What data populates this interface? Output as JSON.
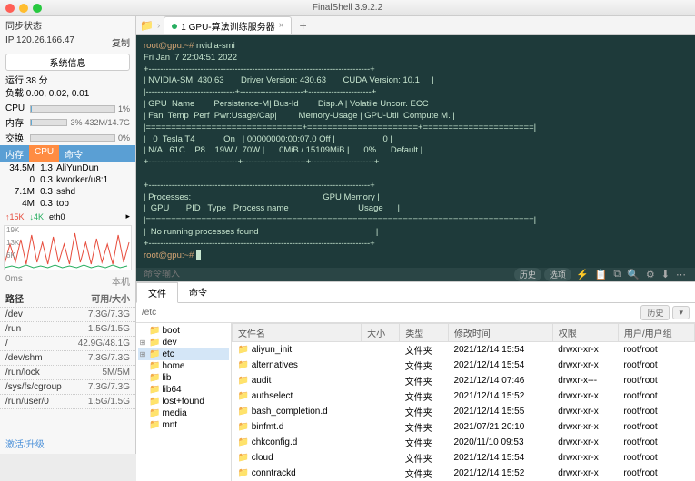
{
  "window": {
    "title": "FinalShell 3.9.2.2"
  },
  "sidebar": {
    "syncLabel": "同步状态",
    "ip": "IP 120.26.166.47",
    "copy": "复制",
    "sysinfo": "系统信息",
    "uptime": "运行 38 分",
    "load": "负载 0.00, 0.02, 0.01",
    "cpu": {
      "label": "CPU",
      "pct": "1%",
      "fill": 1
    },
    "mem": {
      "label": "内存",
      "pct": "3%",
      "val": "432M/14.7G",
      "fill": 3
    },
    "swap": {
      "label": "交换",
      "pct": "0%",
      "fill": 0
    },
    "tabs": {
      "mem": "内存",
      "cpu": "CPU",
      "cmd": "命令"
    },
    "procs": [
      {
        "m": "34.5M",
        "c": "1.3",
        "n": "AliYunDun"
      },
      {
        "m": "0",
        "c": "0.3",
        "n": "kworker/u8:1"
      },
      {
        "m": "7.1M",
        "c": "0.3",
        "n": "sshd"
      },
      {
        "m": "4M",
        "c": "0.3",
        "n": "top"
      }
    ],
    "net": {
      "up": "↑15K",
      "down": "↓4K",
      "iface": "eth0",
      "y1": "19K",
      "y2": "13K",
      "y3": "6K",
      "lat": "0ms",
      "z1": "0",
      "z2": "0"
    },
    "pathHead": {
      "p": "路径",
      "s": "可用/大小"
    },
    "paths": [
      {
        "p": "/dev",
        "s": "7.3G/7.3G"
      },
      {
        "p": "/run",
        "s": "1.5G/1.5G"
      },
      {
        "p": "/",
        "s": "42.9G/48.1G"
      },
      {
        "p": "/dev/shm",
        "s": "7.3G/7.3G"
      },
      {
        "p": "/run/lock",
        "s": "5M/5M"
      },
      {
        "p": "/sys/fs/cgroup",
        "s": "7.3G/7.3G"
      },
      {
        "p": "/run/user/0",
        "s": "1.5G/1.5G"
      }
    ],
    "activate": "激活/升级",
    "local": "本机"
  },
  "tab": {
    "label": "1 GPU-算法训练服务器"
  },
  "terminal": {
    "prompt1": "root@gpu:~# ",
    "cmd1": "nvidia-smi",
    "out": "Fri Jan  7 22:04:51 2022\n+-----------------------------------------------------------------------------+\n| NVIDIA-SMI 430.63       Driver Version: 430.63       CUDA Version: 10.1     |\n|-------------------------------+----------------------+----------------------+\n| GPU  Name        Persistence-M| Bus-Id        Disp.A | Volatile Uncorr. ECC |\n| Fan  Temp  Perf  Pwr:Usage/Cap|         Memory-Usage | GPU-Util  Compute M. |\n|===============================+======================+======================|\n|   0  Tesla T4            On   | 00000000:00:07.0 Off |                    0 |\n| N/A   61C    P8    19W /  70W |      0MiB / 15109MiB |      0%      Default |\n+-------------------------------+----------------------+----------------------+\n\n+-----------------------------------------------------------------------------+\n| Processes:                                                       GPU Memory |\n|  GPU       PID   Type   Process name                             Usage      |\n|=============================================================================|\n|  No running processes found                                                 |\n+-----------------------------------------------------------------------------+",
    "prompt2": "root@gpu:~# "
  },
  "cmdinput": {
    "placeholder": "命令输入",
    "history": "历史",
    "options": "选项"
  },
  "filepane": {
    "tabs": {
      "file": "文件",
      "cmd": "命令"
    },
    "path": "/etc",
    "historyBtn": "历史",
    "tree": [
      "boot",
      "dev",
      "etc",
      "home",
      "lib",
      "lib64",
      "lost+found",
      "media",
      "mnt"
    ],
    "cols": {
      "name": "文件名",
      "size": "大小",
      "type": "类型",
      "mtime": "修改时间",
      "perm": "权限",
      "owner": "用户/用户组"
    },
    "files": [
      {
        "n": "aliyun_init",
        "t": "文件夹",
        "m": "2021/12/14 15:54",
        "p": "drwxr-xr-x",
        "o": "root/root"
      },
      {
        "n": "alternatives",
        "t": "文件夹",
        "m": "2021/12/14 15:54",
        "p": "drwxr-xr-x",
        "o": "root/root"
      },
      {
        "n": "audit",
        "t": "文件夹",
        "m": "2021/12/14 07:46",
        "p": "drwxr-x---",
        "o": "root/root"
      },
      {
        "n": "authselect",
        "t": "文件夹",
        "m": "2021/12/14 15:52",
        "p": "drwxr-xr-x",
        "o": "root/root"
      },
      {
        "n": "bash_completion.d",
        "t": "文件夹",
        "m": "2021/12/14 15:55",
        "p": "drwxr-xr-x",
        "o": "root/root"
      },
      {
        "n": "binfmt.d",
        "t": "文件夹",
        "m": "2021/07/21 20:10",
        "p": "drwxr-xr-x",
        "o": "root/root"
      },
      {
        "n": "chkconfig.d",
        "t": "文件夹",
        "m": "2020/11/10 09:53",
        "p": "drwxr-xr-x",
        "o": "root/root"
      },
      {
        "n": "cloud",
        "t": "文件夹",
        "m": "2021/12/14 15:54",
        "p": "drwxr-xr-x",
        "o": "root/root"
      },
      {
        "n": "conntrackd",
        "t": "文件夹",
        "m": "2021/12/14 15:52",
        "p": "drwxr-xr-x",
        "o": "root/root"
      }
    ]
  }
}
